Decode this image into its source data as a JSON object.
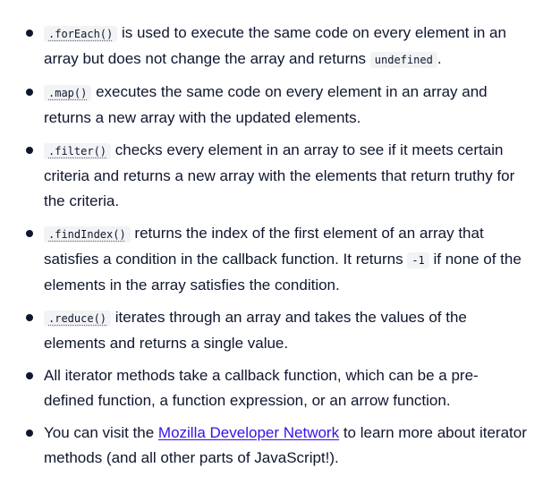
{
  "items": [
    {
      "code": ".forEach()",
      "text1": " is used to execute the same code on every element in an array but does not change the array and returns ",
      "code2": "undefined",
      "text2": "."
    },
    {
      "code": ".map()",
      "text1": " executes the same code on every element in an array and returns a new array with the updated elements."
    },
    {
      "code": ".filter()",
      "text1": " checks every element in an array to see if it meets certain criteria and returns a new array with the elements that return truthy for the criteria."
    },
    {
      "code": ".findIndex()",
      "text1": " returns the index of the first element of an array that satisfies a condition in the callback function. It returns ",
      "code2": "-1",
      "text2": " if none of the elements in the array satisfies the condition."
    },
    {
      "code": ".reduce()",
      "text1": " iterates through an array and takes the values of the elements and returns a single value."
    },
    {
      "text1": "All iterator methods take a callback function, which can be a pre-defined function, a function expression, or an arrow function."
    },
    {
      "text1": "You can visit the ",
      "link": "Mozilla Developer Network",
      "text2": " to learn more about iterator methods (and all other parts of JavaScript!)."
    }
  ]
}
